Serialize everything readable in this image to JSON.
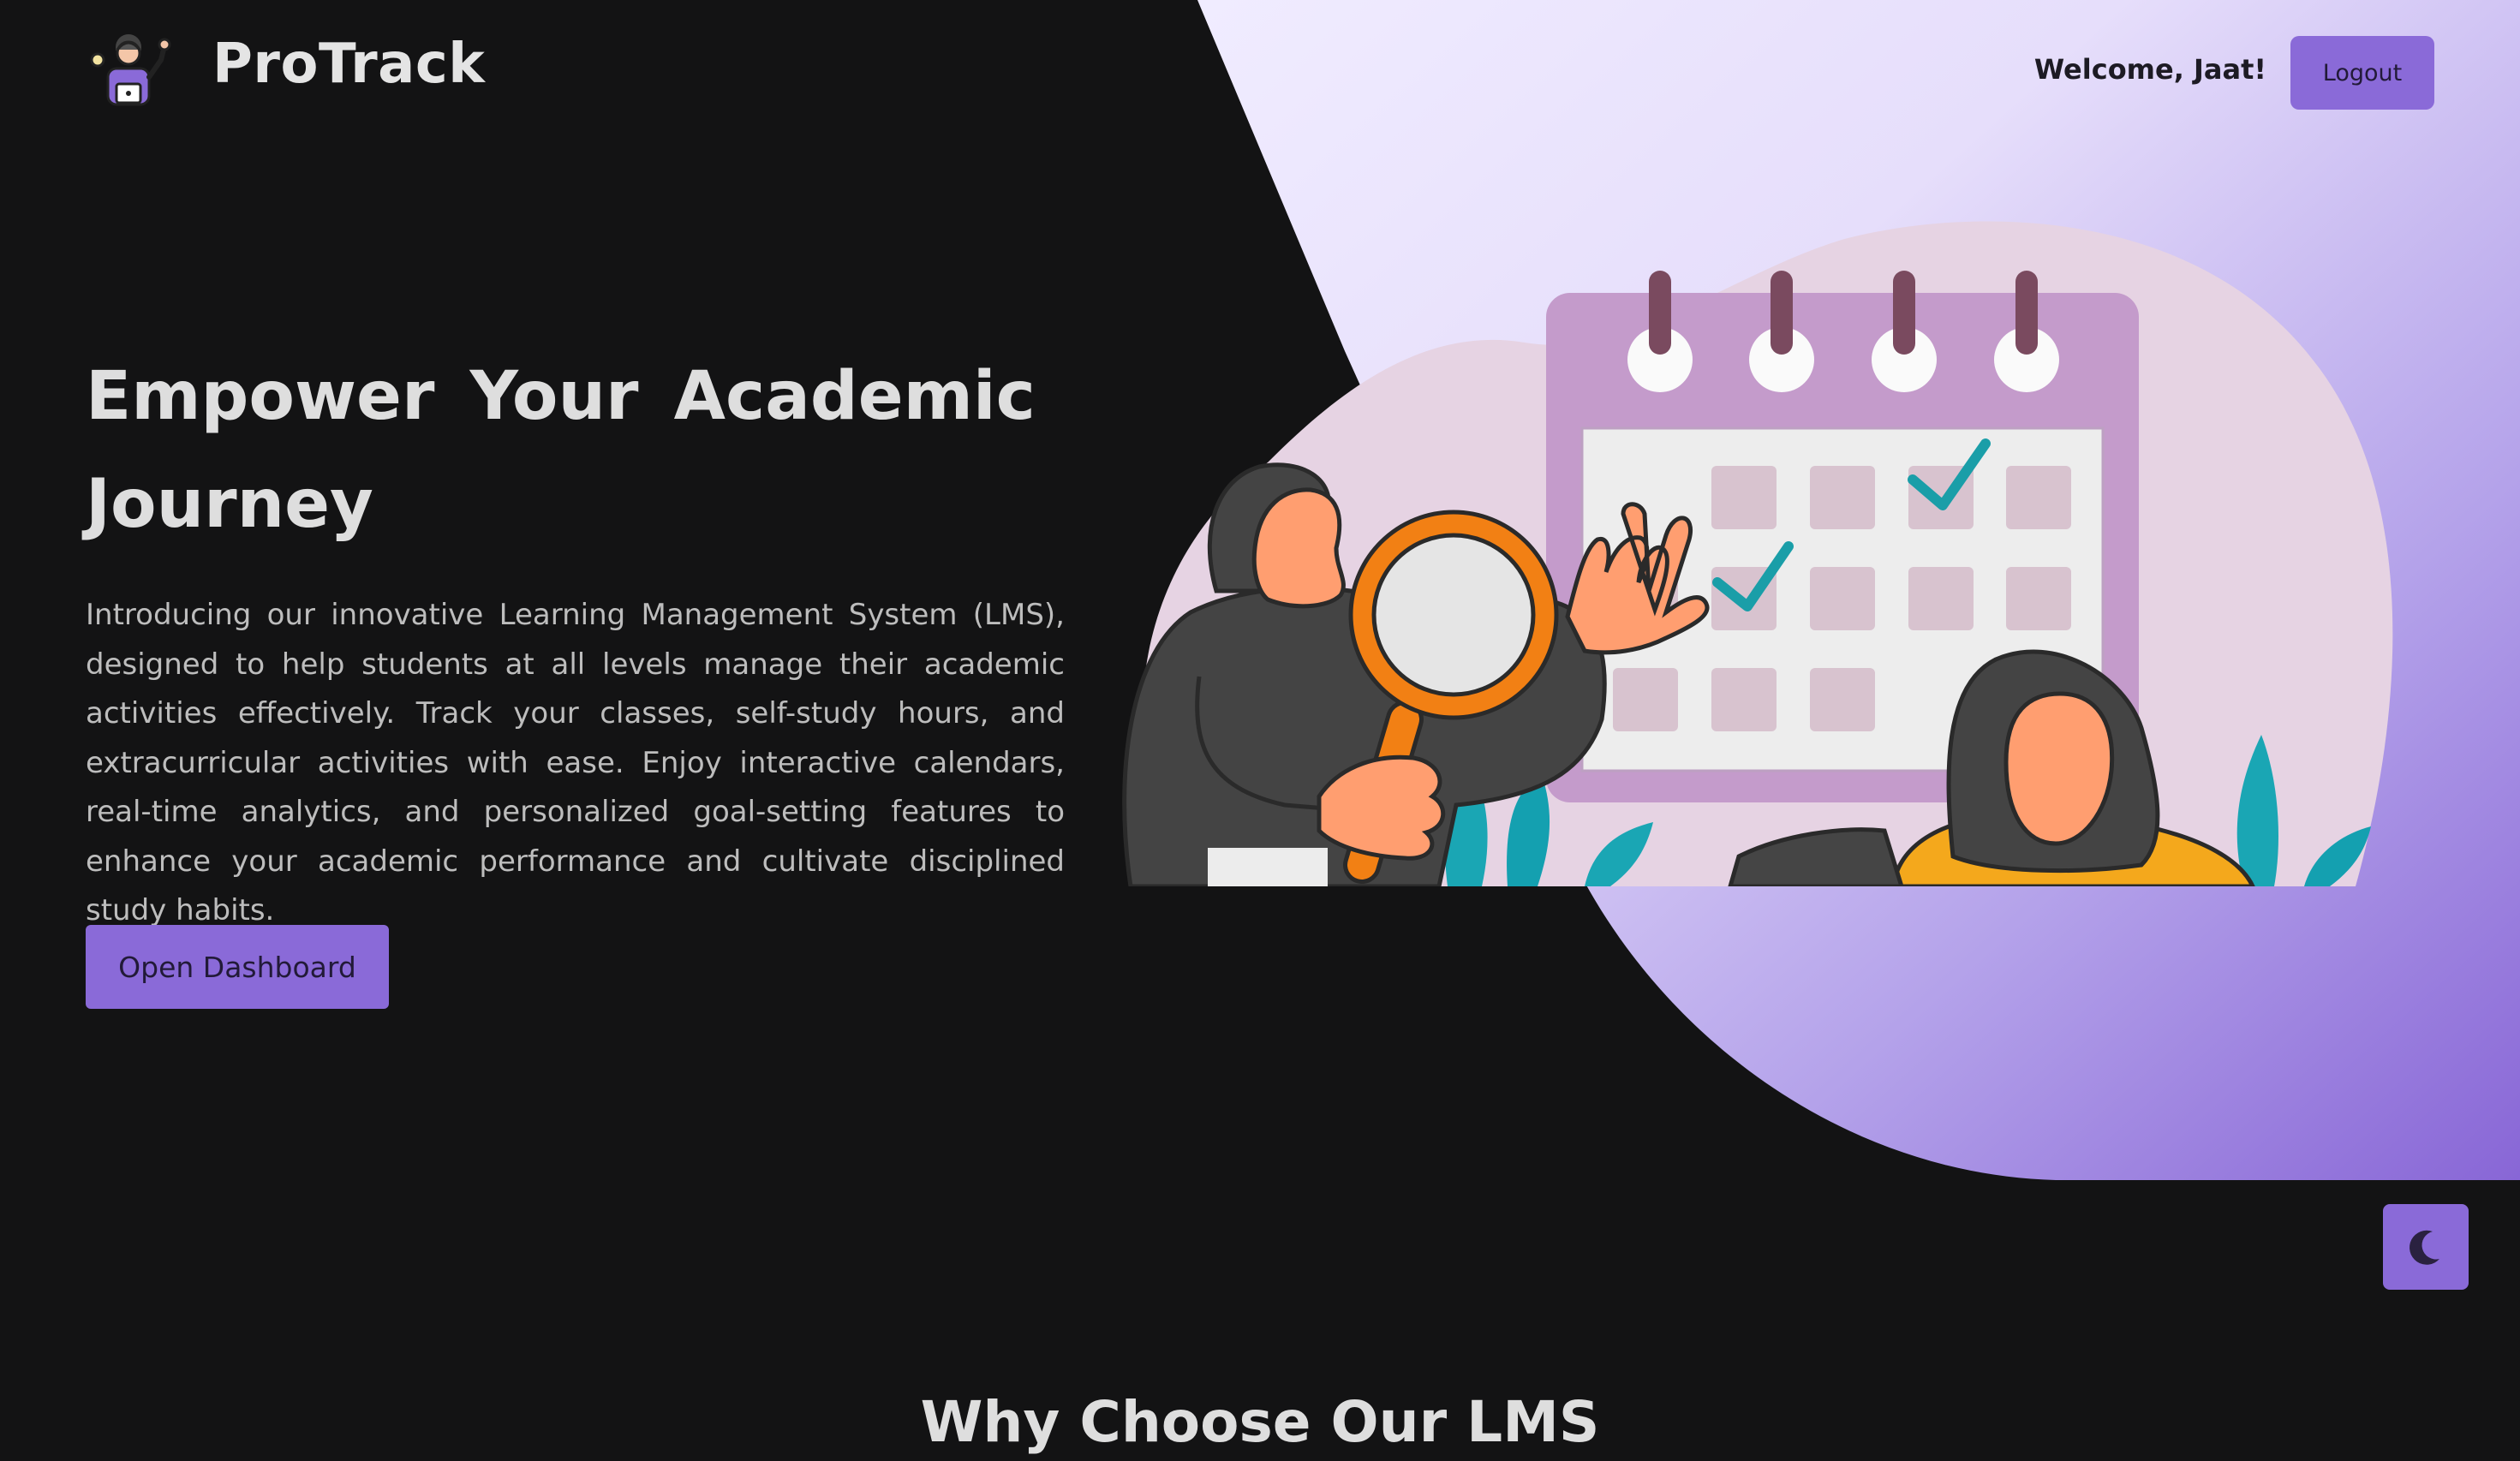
{
  "header": {
    "brand": "ProTrack",
    "welcome": "Welcome, Jaat!",
    "logout_label": "Logout",
    "logo_icon": "student-mascot-icon"
  },
  "hero": {
    "title": "Empower Your Academic Journey",
    "description": "Introducing our innovative Learning Management System (LMS), designed to help students at all levels manage their academic activities effectively. Track your classes, self-study hours, and extracurricular activities with ease. Enjoy interactive calendars, real-time analytics, and personalized goal-setting features to enhance your academic performance and cultivate disciplined study habits.",
    "cta_label": "Open Dashboard",
    "illustration": "calendar-planning-illustration"
  },
  "theme_toggle": {
    "icon": "moon-icon"
  },
  "features": {
    "title": "Why Choose Our LMS"
  },
  "colors": {
    "background": "#131314",
    "accent": "#8a6ad8",
    "accent_text": "#221a38",
    "light_shape_start": "#ece6ff",
    "light_shape_end": "#8c6ed8"
  }
}
